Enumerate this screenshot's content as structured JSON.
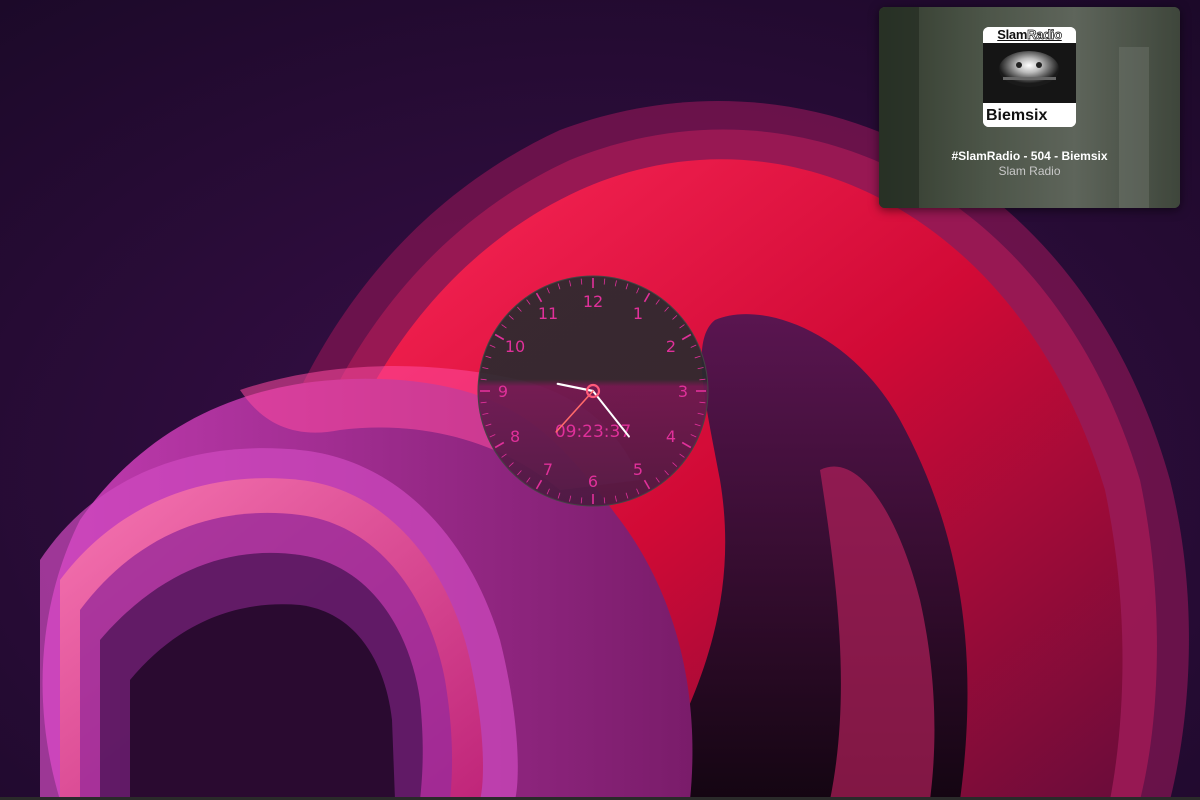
{
  "media": {
    "album_brand_slam": "Slam",
    "album_brand_radio": "Radio",
    "album_artist": "Biemsix",
    "title": "#SlamRadio - 504 - Biemsix",
    "subtitle": "Slam Radio"
  },
  "clock": {
    "numerals": [
      "12",
      "1",
      "2",
      "3",
      "4",
      "5",
      "6",
      "7",
      "8",
      "9",
      "10",
      "11"
    ],
    "digital_time": "09:23:37",
    "hour": 9,
    "minute": 23,
    "second": 37,
    "accent_color": "#e0309a",
    "second_hand_color": "#ff6a6a"
  },
  "icons": {
    "clock_center": "clock-center-pin-icon"
  }
}
